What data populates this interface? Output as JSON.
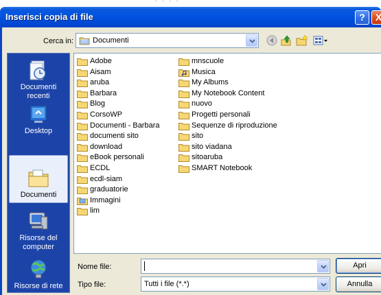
{
  "dialog": {
    "title": "Inserisci copia di file",
    "help_label": "?",
    "close_label": "X"
  },
  "cerca": {
    "label": "Cerca in:",
    "value": "Documenti"
  },
  "places": [
    {
      "label": "Documenti recenti",
      "icon": "recent-documents-icon"
    },
    {
      "label": "Desktop",
      "icon": "desktop-icon"
    },
    {
      "label": "Documenti",
      "icon": "documents-folder-icon"
    },
    {
      "label": "Risorse del computer",
      "icon": "my-computer-icon"
    },
    {
      "label": "Risorse di rete",
      "icon": "network-icon"
    }
  ],
  "files": {
    "col1": [
      {
        "name": "Adobe",
        "icon": "folder-icon"
      },
      {
        "name": "Aisam",
        "icon": "folder-icon"
      },
      {
        "name": "aruba",
        "icon": "folder-icon"
      },
      {
        "name": "Barbara",
        "icon": "folder-icon"
      },
      {
        "name": "Blog",
        "icon": "folder-icon"
      },
      {
        "name": "CorsoWP",
        "icon": "folder-icon"
      },
      {
        "name": "Documenti - Barbara",
        "icon": "folder-icon"
      },
      {
        "name": "documenti sito",
        "icon": "folder-icon"
      },
      {
        "name": "download",
        "icon": "folder-icon"
      },
      {
        "name": "eBook personali",
        "icon": "folder-icon"
      },
      {
        "name": "ECDL",
        "icon": "folder-icon"
      },
      {
        "name": "ecdl-siam",
        "icon": "folder-icon"
      },
      {
        "name": "graduatorie",
        "icon": "folder-icon"
      },
      {
        "name": "Immagini",
        "icon": "pictures-folder-icon"
      },
      {
        "name": "lim",
        "icon": "folder-icon"
      }
    ],
    "col2": [
      {
        "name": "mnscuole",
        "icon": "folder-icon"
      },
      {
        "name": "Musica",
        "icon": "music-folder-icon"
      },
      {
        "name": "My Albums",
        "icon": "folder-icon"
      },
      {
        "name": "My Notebook Content",
        "icon": "folder-icon"
      },
      {
        "name": "nuovo",
        "icon": "folder-icon"
      },
      {
        "name": "Progetti personali",
        "icon": "folder-icon"
      },
      {
        "name": "Sequenze di riproduzione",
        "icon": "folder-icon"
      },
      {
        "name": "sito",
        "icon": "folder-icon"
      },
      {
        "name": "sito viadana",
        "icon": "folder-icon"
      },
      {
        "name": "sitoaruba",
        "icon": "folder-icon"
      },
      {
        "name": "SMART Notebook",
        "icon": "folder-icon"
      }
    ]
  },
  "nome_file": {
    "label": "Nome file:",
    "value": ""
  },
  "tipo_file": {
    "label": "Tipo file:",
    "value": "Tutti i file (*.*)"
  },
  "buttons": {
    "open": "Apri",
    "cancel": "Annulla"
  },
  "colors": {
    "titlebar": "#0053e2",
    "places_bar": "#1c44a8",
    "dialog_bg": "#ece9d8",
    "folder": "#f7d774"
  }
}
